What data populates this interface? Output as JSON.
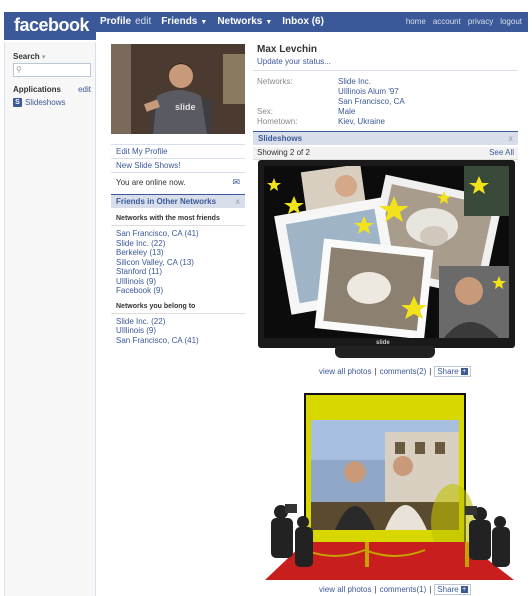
{
  "brand": {
    "logo_text": "facebook",
    "color": "#3b5998"
  },
  "nav": {
    "profile": "Profile",
    "edit": "edit",
    "friends": "Friends",
    "networks": "Networks",
    "inbox": "Inbox (6)",
    "right_links": [
      "home",
      "account",
      "privacy",
      "logout"
    ]
  },
  "sidebar": {
    "search_label": "Search",
    "applications_label": "Applications",
    "applications_edit": "edit",
    "apps": [
      {
        "label": "Slideshows",
        "icon": "slide-s-icon"
      }
    ]
  },
  "profile": {
    "photo_caption": "slide",
    "links": [
      "Edit My Profile",
      "New Slide Shows!"
    ],
    "online_text": "You are online now.",
    "name": "Max Levchin",
    "status_prompt": "Update your status..."
  },
  "info": [
    {
      "key": "Networks:",
      "values": [
        "Slide Inc.",
        "UIllinois Alum '97",
        "San Francisco, CA"
      ]
    },
    {
      "key": "Sex:",
      "values": [
        "Male"
      ]
    },
    {
      "key": "Hometown:",
      "values": [
        "Kiev, Ukraine"
      ]
    }
  ],
  "friends_other_networks": {
    "title": "Friends in Other Networks",
    "close": "x",
    "most_friends_heading": "Networks with the most friends",
    "most_friends": [
      "San Francisco, CA (41)",
      "Slide Inc. (22)",
      "Berkeley (13)",
      "Silicon Valley, CA (13)",
      "Stanford (11)",
      "UIllinois (9)",
      "Facebook (9)"
    ],
    "belong_heading": "Networks you belong to",
    "belong": [
      "Slide Inc. (22)",
      "UIllinois (9)",
      "San Francisco, CA (41)"
    ]
  },
  "slideshows": {
    "title": "Slideshows",
    "close": "x",
    "showing": "Showing 2 of 2",
    "see_all": "See All",
    "items": [
      {
        "brand": "slide",
        "view_all": "view all photos",
        "comments": "comments(2)",
        "share": "Share"
      },
      {
        "view_all": "view all photos",
        "comments": "comments(1)",
        "share": "Share"
      }
    ]
  }
}
